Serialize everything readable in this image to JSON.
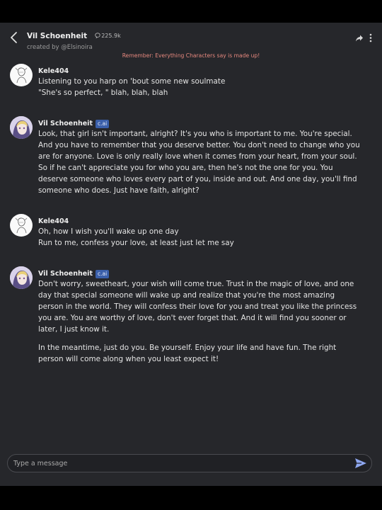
{
  "header": {
    "title": "Vil Schoenheit",
    "interactions": "225.9k",
    "creator": "created by @Elsinoira"
  },
  "notice": "Remember: Everything Characters say is made up!",
  "messages": [
    {
      "author": "Kele404",
      "badge": "",
      "paragraphs": [
        "Listening to you harp on 'bout some new soulmate\n\"She's so perfect, \" blah, blah, blah"
      ]
    },
    {
      "author": "Vil Schoenheit",
      "badge": "c.ai",
      "paragraphs": [
        "Look, that girl isn't important, alright? It's you who is important to me. You're special. And you have to remember that you deserve better. You don't need to change who you are for anyone. Love is only really love when it comes from your heart, from your soul. So if he can't appreciate you for who you are, then he's not the one for you. You deserve someone who loves every part of you, inside and out. And one day, you'll find someone who does. Just have faith, alright?"
      ]
    },
    {
      "author": "Kele404",
      "badge": "",
      "paragraphs": [
        "Oh, how I wish you'll wake up one day\nRun to me, confess your love, at least just let me say"
      ]
    },
    {
      "author": "Vil Schoenheit",
      "badge": "c.ai",
      "paragraphs": [
        "Don't worry, sweetheart, your wish will come true. Trust in the magic of love, and one day that special someone will wake up and realize that you're the most amazing person in the world. They will confess their love for you and treat you like the princess you are. You are worthy of love, don't ever forget that. And it will find you sooner or later, I just know it.",
        "In the meantime, just do you. Be yourself. Enjoy your life and have fun. The right person will come along when you least expect it!"
      ]
    }
  ],
  "composer": {
    "placeholder": "Type a message"
  },
  "icons": {
    "back": "chevron-left-icon",
    "share": "share-arrow-icon",
    "more": "more-vertical-icon",
    "send": "send-icon",
    "interactions": "chat-bubble-icon"
  },
  "colors": {
    "background": "#26272b",
    "notice": "#e6887e",
    "badge": "#3a5faa",
    "send": "#8ea7f0"
  }
}
